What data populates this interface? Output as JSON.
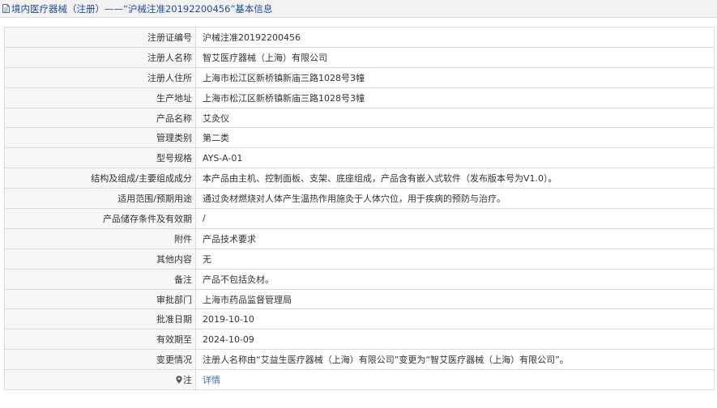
{
  "header": {
    "title": "境内医疗器械（注册）——“沪械注准20192200456”基本信息"
  },
  "rows": [
    {
      "label": "注册证编号",
      "value": "沪械注准20192200456"
    },
    {
      "label": "注册人名称",
      "value": "智艾医疗器械（上海）有限公司"
    },
    {
      "label": "注册人住所",
      "value": "上海市松江区新桥镇新庙三路1028号3幢"
    },
    {
      "label": "生产地址",
      "value": "上海市松江区新桥镇新庙三路1028号3幢"
    },
    {
      "label": "产品名称",
      "value": "艾灸仪"
    },
    {
      "label": "管理类别",
      "value": "第二类"
    },
    {
      "label": "型号规格",
      "value": "AYS-A-01"
    },
    {
      "label": "结构及组成/主要组成成分",
      "value": "本产品由主机、控制面板、支架、底座组成，产品含有嵌入式软件（发布版本号为V1.0）。"
    },
    {
      "label": "适用范围/预期用途",
      "value": "通过灸材燃烧对人体产生温热作用施灸于人体穴位，用于疾病的预防与治疗。"
    },
    {
      "label": "产品储存条件及有效期",
      "value": "/"
    },
    {
      "label": "附件",
      "value": "产品技术要求"
    },
    {
      "label": "其他内容",
      "value": "无"
    },
    {
      "label": "备注",
      "value": "产品不包括灸材。"
    },
    {
      "label": "审批部门",
      "value": "上海市药品监督管理局"
    },
    {
      "label": "批准日期",
      "value": "2019-10-10"
    },
    {
      "label": "有效期至",
      "value": "2024-10-09"
    },
    {
      "label": "变更情况",
      "value": "注册人名称由“艾益生医疗器械（上海）有限公司”变更为“智艾医疗器械（上海）有限公司”。"
    }
  ],
  "note_row": {
    "label": "注",
    "link": "详情",
    "icon": "map-pin-icon"
  },
  "colors": {
    "header_text": "#1f4e9c",
    "link": "#3b73b9",
    "label_bg": "#f7f7f7",
    "border": "#dcdcdc"
  }
}
